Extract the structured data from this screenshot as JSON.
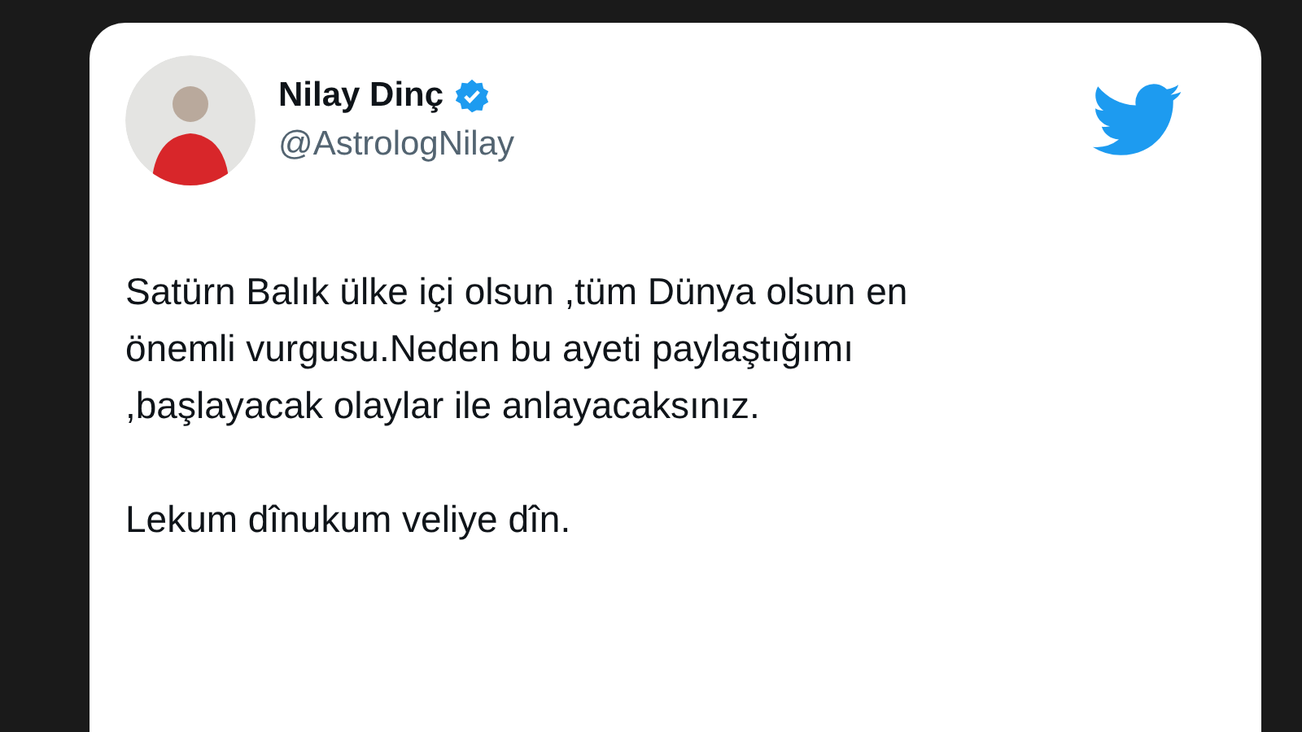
{
  "tweet": {
    "author": {
      "name": "Nilay Dinç",
      "handle": "@AstrologNilay",
      "verified": true
    },
    "paragraphs": [
      "Satürn Balık ülke içi olsun ,tüm Dünya olsun en önemli vurgusu.Neden bu ayeti paylaştığımı ,başlayacak olaylar ile anlayacaksınız.",
      "Lekum dînukum veliye dîn."
    ]
  }
}
